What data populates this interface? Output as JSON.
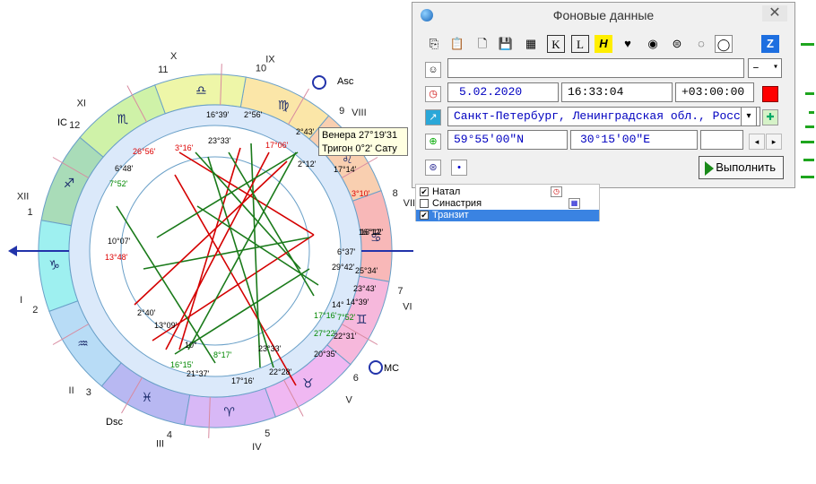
{
  "window": {
    "title": "Фоновые данные",
    "close_label": "✕"
  },
  "toolbar": {
    "items": [
      {
        "name": "copy-icon",
        "glyph": "⎘"
      },
      {
        "name": "paste-icon",
        "glyph": "📋"
      },
      {
        "name": "new-doc-icon",
        "glyph": "🗋"
      },
      {
        "name": "save-icon",
        "glyph": "💾"
      },
      {
        "name": "calendar-icon",
        "glyph": "▦"
      },
      {
        "name": "k-icon",
        "glyph": "K"
      },
      {
        "name": "l-icon",
        "glyph": "L"
      },
      {
        "name": "h-icon",
        "glyph": "H"
      },
      {
        "name": "heart-icon",
        "glyph": "♥"
      },
      {
        "name": "circle-eye-icon",
        "glyph": "◉"
      },
      {
        "name": "sigma-icon",
        "glyph": "⊜"
      },
      {
        "name": "dot-circle-icon",
        "glyph": "◌"
      },
      {
        "name": "ring-icon",
        "glyph": "◯"
      },
      {
        "name": "z-icon",
        "glyph": "Z"
      }
    ]
  },
  "form": {
    "name_value": "",
    "name_combo": "–",
    "date": "5.02.2020",
    "time": "16:33:04",
    "tz": "+03:00:00",
    "place": "Санкт-Петербург, Ленинградская обл., Росс",
    "lat": "59°55'00\"N",
    "lon": "30°15'00\"E",
    "extra": "",
    "execute_label": "Выполнить"
  },
  "colors": {
    "accent_red": "#ff0000",
    "sign_ring_fire": "#f8c0c0"
  },
  "dropdown": {
    "items": [
      {
        "label": "Натал",
        "checked": true,
        "selected": false
      },
      {
        "label": "Синастрия",
        "checked": false,
        "selected": false
      },
      {
        "label": "Транзит",
        "checked": true,
        "selected": true
      }
    ]
  },
  "tooltip": {
    "line1": "Венера 27°19'31",
    "line2": "Тригон 0°2' Сату"
  },
  "chart": {
    "house_roman": [
      "I",
      "II",
      "III",
      "IV",
      "V",
      "VI",
      "VII",
      "VIII",
      "IX",
      "X",
      "XI",
      "XII"
    ],
    "house_numbers": [
      "1",
      "2",
      "3",
      "4",
      "5",
      "6",
      "7",
      "8",
      "9",
      "10",
      "11",
      "12"
    ],
    "axis_labels": {
      "asc": "Asc",
      "ic": "IC",
      "dsc": "Dsc",
      "mc": "MC"
    },
    "sign_glyphs": [
      "♈",
      "♉",
      "♊",
      "♋",
      "♌",
      "♍",
      "♎",
      "♏",
      "♐",
      "♑",
      "♒",
      "♓"
    ],
    "outer_labels": [
      {
        "text": "16°39'",
        "color": "#000"
      },
      {
        "text": "2°56'",
        "color": "#000"
      },
      {
        "text": "23°33'",
        "color": "#000"
      },
      {
        "text": "17°06'",
        "color": "#d00"
      },
      {
        "text": "2°43'",
        "color": "#000"
      },
      {
        "text": "2°12'",
        "color": "#000"
      },
      {
        "text": "17°14'",
        "color": "#000"
      },
      {
        "text": "3°10'",
        "color": "#d00"
      },
      {
        "text": "16°12'",
        "color": "#000"
      },
      {
        "text": "6°37'",
        "color": "#000"
      },
      {
        "text": "29°42'",
        "color": "#000"
      },
      {
        "text": "25°34'",
        "color": "#000"
      },
      {
        "text": "23°43'",
        "color": "#000"
      },
      {
        "text": "14°39'",
        "color": "#000"
      },
      {
        "text": "7°52'",
        "color": "#080"
      },
      {
        "text": "22°31'",
        "color": "#000"
      },
      {
        "text": "20°35'",
        "color": "#000"
      },
      {
        "text": "22°28'",
        "color": "#000"
      },
      {
        "text": "17°16'",
        "color": "#000"
      },
      {
        "text": "8°17'",
        "color": "#080"
      },
      {
        "text": "21°37'",
        "color": "#000"
      },
      {
        "text": "16°15'",
        "color": "#080"
      },
      {
        "text": "13°09'",
        "color": "#000"
      },
      {
        "text": "2°40'",
        "color": "#000"
      },
      {
        "text": "13°48'",
        "color": "#d00"
      },
      {
        "text": "10°07'",
        "color": "#000"
      },
      {
        "text": "7°52'",
        "color": "#080"
      },
      {
        "text": "6°48'",
        "color": "#000"
      },
      {
        "text": "26°56'",
        "color": "#d00"
      },
      {
        "text": "3°16'",
        "color": "#d00"
      },
      {
        "text": "23°33'",
        "color": "#000"
      },
      {
        "text": "27°22'",
        "color": "#080"
      },
      {
        "text": "17°16'",
        "color": "#080"
      },
      {
        "text": "16°12'",
        "color": "#000"
      },
      {
        "text": "10°",
        "color": "#000"
      },
      {
        "text": "14°",
        "color": "#000"
      }
    ]
  }
}
